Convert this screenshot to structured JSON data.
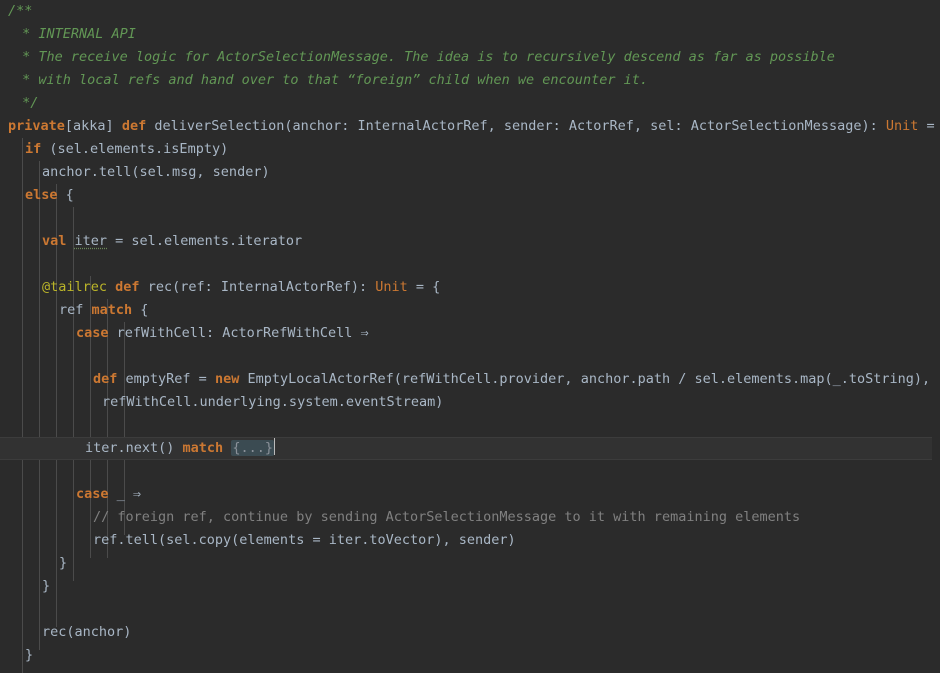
{
  "editor": {
    "theme": "darcula",
    "background": "#2b2b2b",
    "foreground": "#a9b7c6",
    "keyword_color": "#cc7832",
    "doc_comment_color": "#629755",
    "line_comment_color": "#808080",
    "annotation_color": "#bbb529",
    "current_line_background": "#323232",
    "language": "Scala",
    "font_size": "13.5px",
    "line_height": "23px"
  },
  "cursor": {
    "line_index": 14,
    "column_label": "after-fold-placeholder"
  },
  "fold": {
    "placeholder": "{...}"
  },
  "code": {
    "lines": [
      {
        "index": 0,
        "indent": 0,
        "text": "/**"
      },
      {
        "index": 1,
        "indent": 0,
        "text": " * INTERNAL API"
      },
      {
        "index": 2,
        "indent": 0,
        "text": " * The receive logic for ActorSelectionMessage. The idea is to recursively descend as far as possible"
      },
      {
        "index": 3,
        "indent": 0,
        "text": " * with local refs and hand over to that “foreign” child when we encounter it."
      },
      {
        "index": 4,
        "indent": 0,
        "text": " */"
      },
      {
        "index": 5,
        "indent": 0,
        "text": "private[akka] def deliverSelection(anchor: InternalActorRef, sender: ActorRef, sel: ActorSelectionMessage): Unit ="
      },
      {
        "index": 6,
        "indent": 1,
        "text": "if (sel.elements.isEmpty)"
      },
      {
        "index": 7,
        "indent": 2,
        "text": "anchor.tell(sel.msg, sender)"
      },
      {
        "index": 8,
        "indent": 1,
        "text": "else {"
      },
      {
        "index": 9,
        "indent": 0,
        "text": ""
      },
      {
        "index": 10,
        "indent": 2,
        "text": "val iter = sel.elements.iterator"
      },
      {
        "index": 11,
        "indent": 0,
        "text": ""
      },
      {
        "index": 12,
        "indent": 2,
        "text": "@tailrec def rec(ref: InternalActorRef): Unit = {"
      },
      {
        "index": 13,
        "indent": 3,
        "text": "ref match {"
      },
      {
        "index": 14,
        "indent": 4,
        "text": "case refWithCell: ActorRefWithCell ⇒"
      },
      {
        "index": 15,
        "indent": 0,
        "text": ""
      },
      {
        "index": 16,
        "indent": 5,
        "text": "def emptyRef = new EmptyLocalActorRef(refWithCell.provider, anchor.path / sel.elements.map(_.toString),"
      },
      {
        "index": 17,
        "indent": 5,
        "text": "refWithCell.underlying.system.eventStream)"
      },
      {
        "index": 18,
        "indent": 0,
        "text": ""
      },
      {
        "index": 19,
        "indent": 5,
        "text": "iter.next() match {...}"
      },
      {
        "index": 20,
        "indent": 0,
        "text": ""
      },
      {
        "index": 21,
        "indent": 4,
        "text": "case _ ⇒"
      },
      {
        "index": 22,
        "indent": 5,
        "text": "// foreign ref, continue by sending ActorSelectionMessage to it with remaining elements"
      },
      {
        "index": 23,
        "indent": 5,
        "text": "ref.tell(sel.copy(elements = iter.toVector), sender)"
      },
      {
        "index": 24,
        "indent": 3,
        "text": "}"
      },
      {
        "index": 25,
        "indent": 2,
        "text": "}"
      },
      {
        "index": 26,
        "indent": 0,
        "text": ""
      },
      {
        "index": 27,
        "indent": 2,
        "text": "rec(anchor)"
      },
      {
        "index": 28,
        "indent": 1,
        "text": "}"
      }
    ],
    "tokens": {
      "doc_open": "/**",
      "doc_l1": " * INTERNAL API",
      "doc_l2_a": " * The receive logic for ",
      "doc_l2_b": "ActorSelectionMessage",
      "doc_l2_c": ". The idea is to recursively descend as far as possible",
      "doc_l3": " * with local refs and hand over to that “foreign” child when we encounter it.",
      "doc_close": " */",
      "kw_private": "private",
      "akka_brackets": "[akka]",
      "kw_def": "def",
      "fn_deliverSelection": " deliverSelection(anchor: InternalActorRef, sender: ActorRef, sel: ActorSelectionMessage): ",
      "type_unit": "Unit",
      "eq_tail": " =",
      "kw_if": "if",
      "if_cond": " (sel.elements.isEmpty)",
      "anchor_tell": "anchor.tell(sel.msg, sender)",
      "kw_else": "else",
      "else_brace": " {",
      "kw_val": "val",
      "val_name": "iter",
      "val_rhs": " = sel.elements.iterator",
      "anno_tailrec": "@tailrec",
      "kw_def2": "def",
      "rec_sig_a": " rec(ref: InternalActorRef): ",
      "rec_unit": "Unit",
      "rec_sig_b": " = {",
      "ref_word": "ref ",
      "kw_match": "match",
      "match_brace": " {",
      "kw_case1": "case",
      "case1_rest": " refWithCell: ActorRefWithCell ⇒",
      "kw_def3": "def",
      "empty_ref_name": " emptyRef = ",
      "kw_new": "new",
      "empty_ref_rest": " EmptyLocalActorRef(refWithCell.provider, anchor.path / sel.elements.map(_.toString),",
      "empty_ref_cont": "refWithCell.underlying.system.eventStream)",
      "iter_next": "iter.next() ",
      "kw_match2": "match",
      "fold_ph": "{...}",
      "kw_case2": "case",
      "case2_rest": " _ ⇒",
      "line_comment": "// foreign ref, continue by sending ActorSelectionMessage to it with remaining elements",
      "ref_tell": "ref.tell(sel.copy(elements = iter.toVector), sender)",
      "close_brace_1": "}",
      "close_brace_2": "}",
      "rec_call": "rec(anchor)",
      "close_brace_3": "}"
    }
  }
}
